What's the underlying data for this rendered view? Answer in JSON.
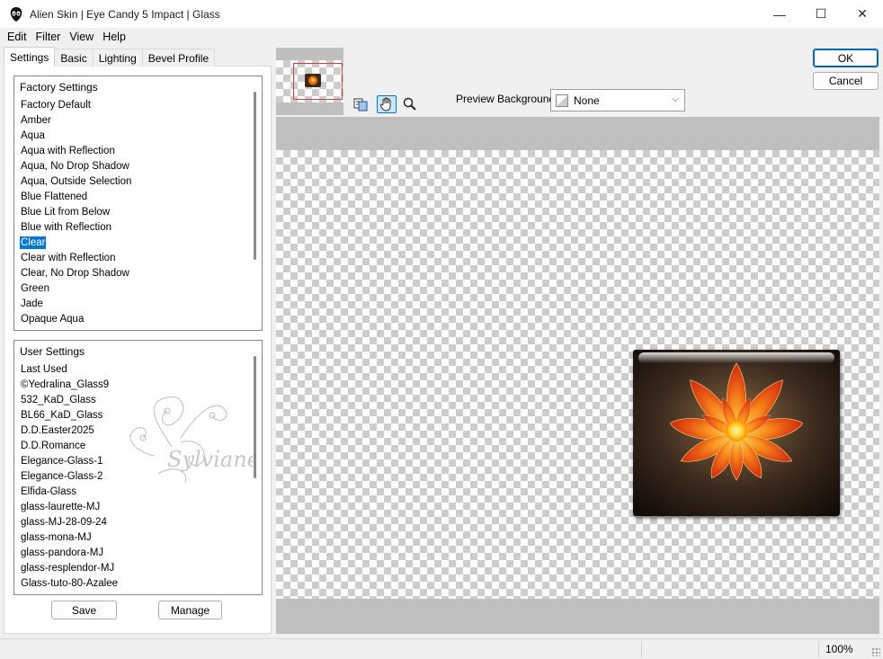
{
  "window": {
    "title": "Alien Skin | Eye Candy 5 Impact | Glass",
    "minimize": "—",
    "maximize": "☐",
    "close": "✕"
  },
  "menu": [
    "Edit",
    "Filter",
    "View",
    "Help"
  ],
  "tabs": [
    "Settings",
    "Basic",
    "Lighting",
    "Bevel Profile"
  ],
  "factory": {
    "header": "Factory Settings",
    "items": [
      "Factory Default",
      "Amber",
      "Aqua",
      "Aqua with Reflection",
      "Aqua, No Drop Shadow",
      "Aqua, Outside Selection",
      "Blue Flattened",
      "Blue Lit from Below",
      "Blue with Reflection",
      "Clear",
      "Clear with Reflection",
      "Clear, No Drop Shadow",
      "Green",
      "Jade",
      "Opaque Aqua"
    ],
    "selected": "Clear"
  },
  "user": {
    "header": "User Settings",
    "items": [
      "Last Used",
      "©Yedralina_Glass9",
      "532_KaD_Glass",
      "BL66_KaD_Glass",
      "D.D.Easter2025",
      "D.D.Romance",
      "Elegance-Glass-1",
      "Elegance-Glass-2",
      "Elfida-Glass",
      "glass-laurette-MJ",
      "glass-MJ-28-09-24",
      "glass-mona-MJ",
      "glass-pandora-MJ",
      "glass-resplendor-MJ",
      "Glass-tuto-80-Azalee"
    ],
    "watermark": "Sylviane"
  },
  "buttons": {
    "save": "Save",
    "manage": "Manage",
    "ok": "OK",
    "cancel": "Cancel"
  },
  "preview": {
    "background_label": "Preview Background:",
    "background_value": "None"
  },
  "status": {
    "zoom": "100%"
  },
  "colors": {
    "selection": "#0078d7",
    "default_button_border": "#0067c0",
    "navigator_frame": "#e23a3a"
  },
  "icons": [
    "app-icon",
    "compare-preview-icon",
    "hand-pan-icon",
    "zoom-magnifier-icon",
    "chevron-down-icon"
  ]
}
